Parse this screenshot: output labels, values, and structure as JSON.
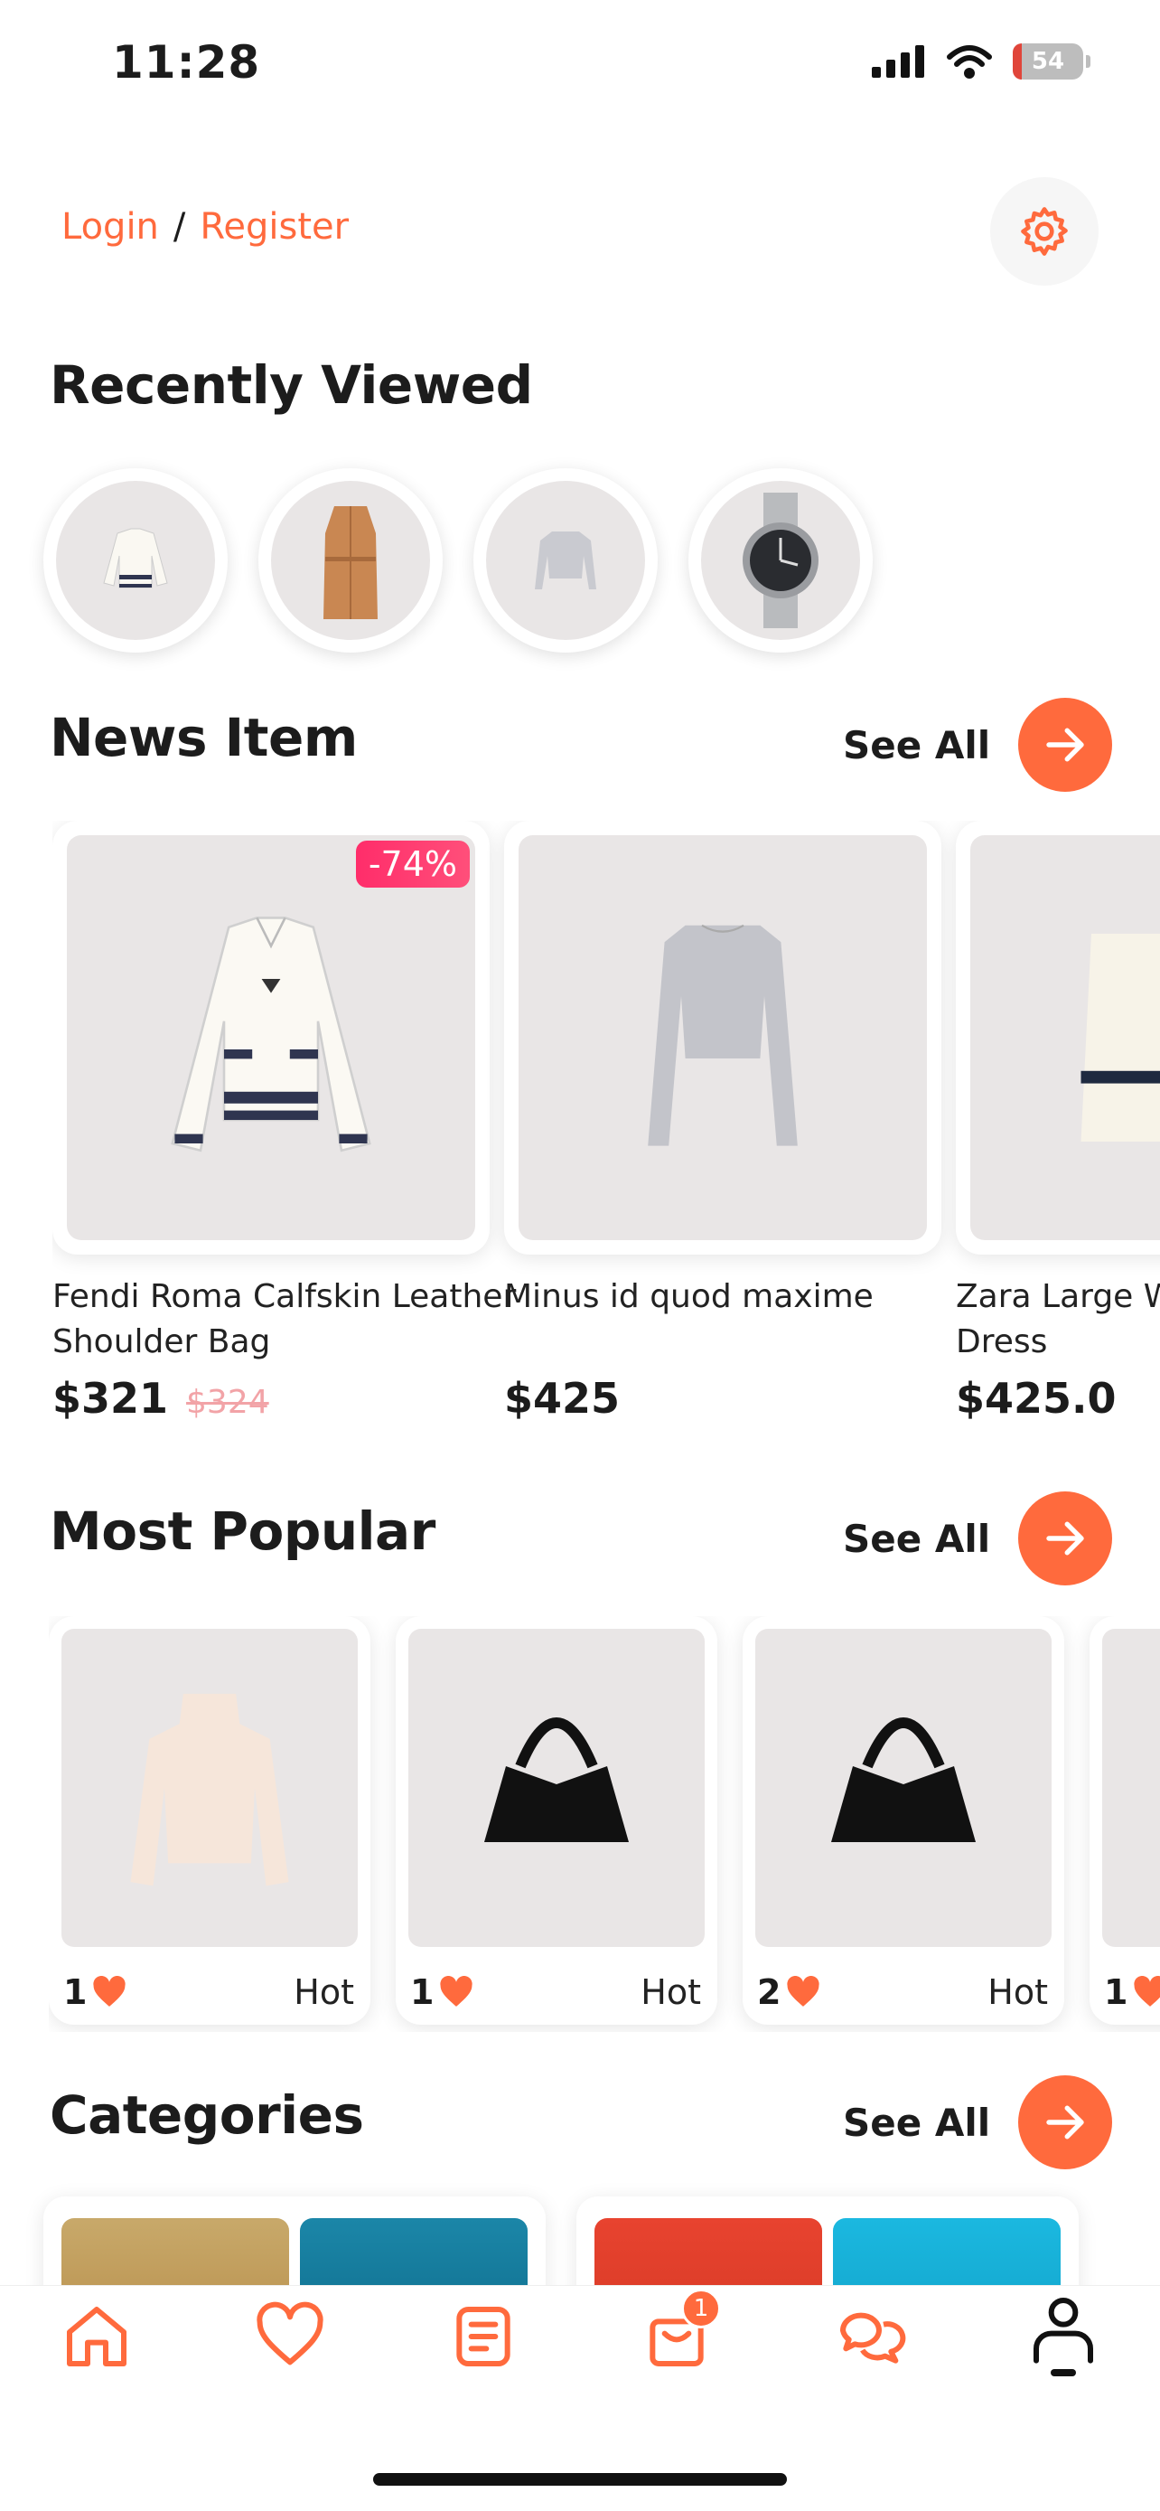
{
  "status": {
    "time": "11:28",
    "battery": "54"
  },
  "auth": {
    "login": "Login",
    "separator": "/",
    "register": "Register"
  },
  "recently_viewed": {
    "title": "Recently Viewed"
  },
  "news": {
    "title": "News Item",
    "see_all": "See All",
    "items": [
      {
        "name_line1": "Fendi Roma Calfskin Leather",
        "name_line2": "Shoulder Bag",
        "price": "$321",
        "old_price": "$324",
        "discount": "-74%"
      },
      {
        "name_line1": "Minus id quod maxime",
        "name_line2": "",
        "price": "$425"
      },
      {
        "name_line1": "Zara Large We",
        "name_line2": "Dress",
        "price": "$425.0"
      }
    ]
  },
  "popular": {
    "title": "Most Popular",
    "see_all": "See All",
    "items": [
      {
        "likes": "1",
        "tag": "Hot"
      },
      {
        "likes": "1",
        "tag": "Hot"
      },
      {
        "likes": "2",
        "tag": "Hot"
      },
      {
        "likes": "1",
        "tag": ""
      }
    ]
  },
  "categories": {
    "title": "Categories",
    "see_all": "See All"
  },
  "tabbar": {
    "cart_badge": "1"
  },
  "colors": {
    "accent": "#ff6a3d",
    "discount": "#ff2d6a",
    "image_bg": "#e9e6e6"
  },
  "icons": [
    "settings-gear-icon",
    "arrow-right-icon",
    "heart-icon",
    "home-icon",
    "list-icon",
    "cart-icon",
    "chat-icon",
    "user-icon"
  ]
}
